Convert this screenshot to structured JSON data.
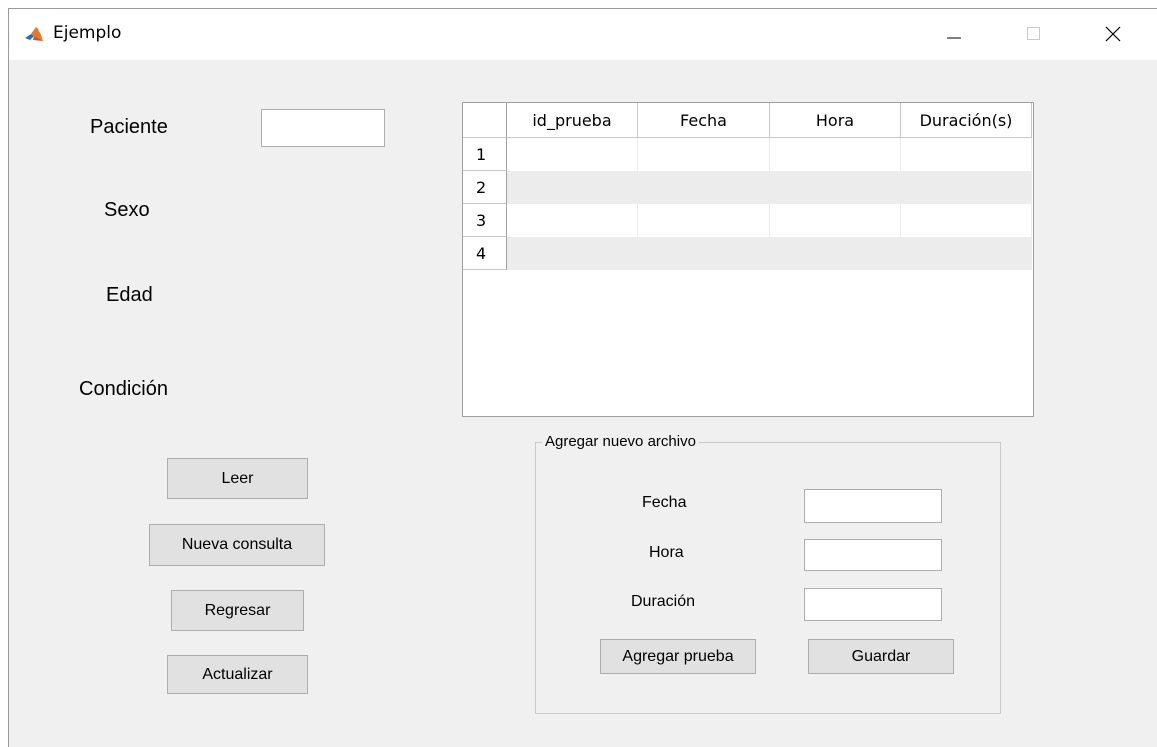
{
  "window": {
    "title": "Ejemplo",
    "icon": "matlab-icon",
    "controls": [
      "minimize-icon",
      "maximize-icon",
      "close-icon"
    ]
  },
  "form": {
    "labels": {
      "paciente": "Paciente",
      "sexo": "Sexo",
      "edad": "Edad",
      "condicion": "Condición"
    },
    "paciente_value": ""
  },
  "buttons": {
    "leer": "Leer",
    "nueva_consulta": "Nueva consulta",
    "regresar": "Regresar",
    "actualizar": "Actualizar"
  },
  "table": {
    "columns": [
      "id_prueba",
      "Fecha",
      "Hora",
      "Duración(s)"
    ],
    "row_numbers": [
      "1",
      "2",
      "3",
      "4"
    ],
    "rows": [
      [
        "",
        "",
        "",
        ""
      ],
      [
        "",
        "",
        "",
        ""
      ],
      [
        "",
        "",
        "",
        ""
      ],
      [
        "",
        "",
        "",
        ""
      ]
    ]
  },
  "panel": {
    "title": "Agregar nuevo archivo",
    "fecha_label": "Fecha",
    "hora_label": "Hora",
    "duracion_label": "Duración",
    "fecha_value": "",
    "hora_value": "",
    "duracion_value": "",
    "agregar_button": "Agregar prueba",
    "guardar_button": "Guardar"
  },
  "colors": {
    "window_bg": "#f0f0f0",
    "button_bg": "#e1e1e1",
    "stripe": "#ececec"
  }
}
